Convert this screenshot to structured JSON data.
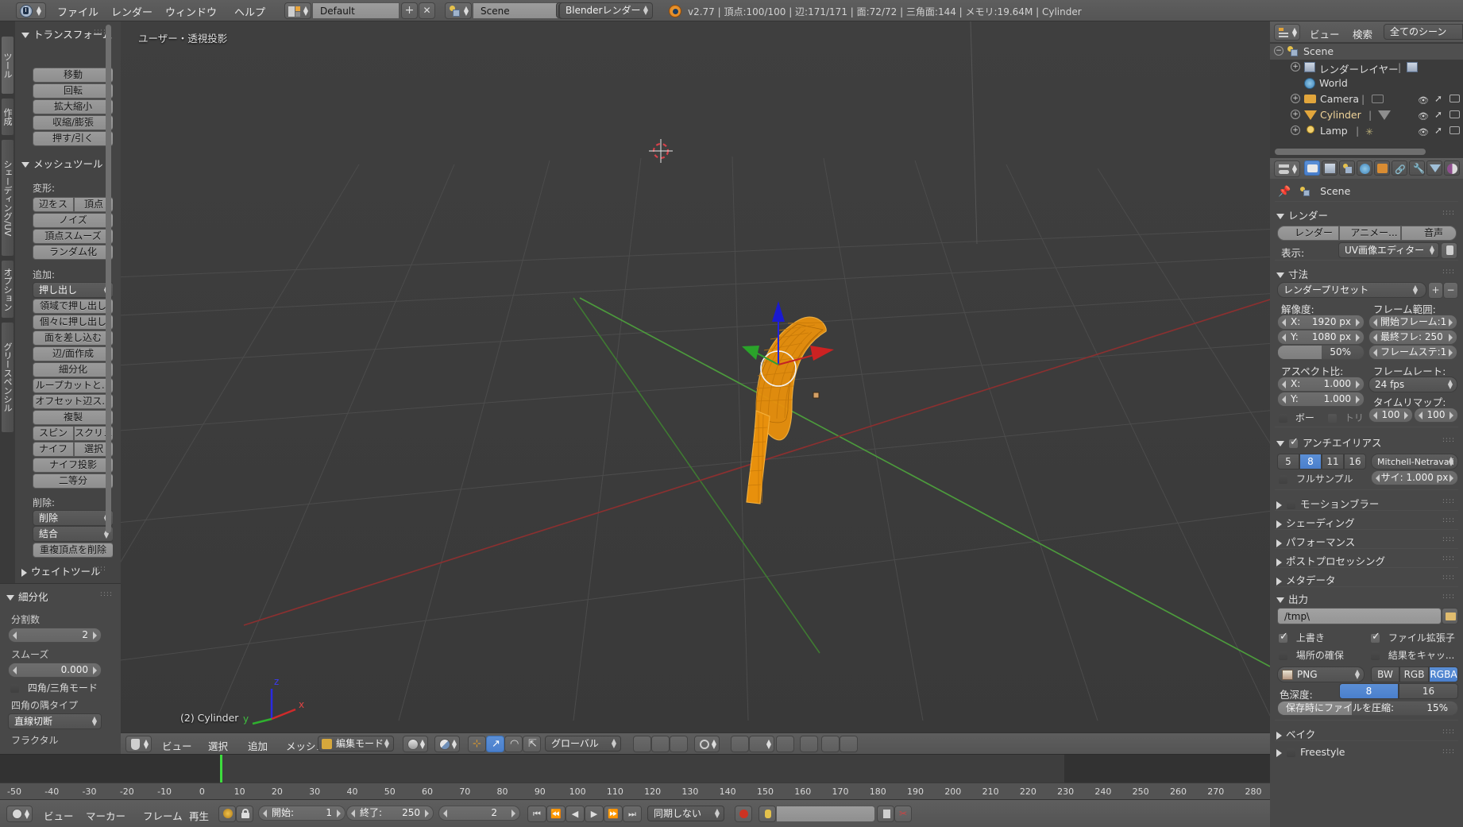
{
  "topbar": {
    "menus": [
      "ファイル",
      "レンダー",
      "ウィンドウ",
      "ヘルプ"
    ],
    "screen_layout": "Default",
    "scene_name": "Scene",
    "render_engine": "Blenderレンダー",
    "status": "v2.77 | 頂点:100/100 | 辺:171/171 | 面:72/72 | 三角面:144 | メモリ:19.64M | Cylinder"
  },
  "toolshelf": {
    "tabs": [
      "ツール",
      "作成",
      "シェーディング/UV",
      "オプション",
      "グリースペンシル"
    ],
    "transform": {
      "title": "トランスフォーム",
      "buttons": [
        "移動",
        "回転",
        "拡大縮小",
        "収縮/膨張",
        "押す/引く"
      ]
    },
    "meshtools": {
      "title": "メッシュツール",
      "deform_label": "変形:",
      "deform_buttons": [
        "辺をス",
        "頂点"
      ],
      "deform_rows": [
        "ノイズ",
        "頂点スムーズ",
        "ランダム化"
      ],
      "add_label": "追加:",
      "add_dropdown": "押し出し",
      "add_rows": [
        "領域で押し出し",
        "個々に押し出し",
        "面を差し込む",
        "辺/面作成",
        "細分化",
        "ループカットと...",
        "オフセット辺ス...",
        "複製"
      ],
      "pair1": [
        "スピン",
        "スクリュ"
      ],
      "pair2": [
        "ナイフ",
        "選択"
      ],
      "add_rows2": [
        "ナイフ投影",
        "二等分"
      ],
      "remove_label": "削除:",
      "remove_dd1": "削除",
      "remove_dd2": "結合",
      "remove_btn": "重複頂点を削除",
      "weight_title": "ウェイトツール"
    },
    "subdivide": {
      "title": "細分化",
      "cuts_label": "分割数",
      "cuts_value": "2",
      "smooth_label": "スムーズ",
      "smooth_value": "0.000",
      "quadtri_label": "四角/三角モード",
      "corner_label": "四角の隅タイプ",
      "corner_value": "直線切断",
      "fractal_label": "フラクタル"
    }
  },
  "viewport": {
    "view_label": "ユーザー・透視投影",
    "object_label": "(2) Cylinder",
    "axis_x": "x",
    "axis_y": "y",
    "axis_z": "z",
    "header_menus": [
      "ビュー",
      "選択",
      "追加",
      "メッシュ"
    ],
    "mode": "編集モード",
    "transform_orientation": "グローバル"
  },
  "timeline": {
    "ruler_ticks": [
      "-50",
      "-40",
      "-30",
      "-20",
      "-10",
      "0",
      "10",
      "20",
      "30",
      "40",
      "50",
      "60",
      "70",
      "80",
      "90",
      "100",
      "110",
      "120",
      "130",
      "140",
      "150",
      "160",
      "170",
      "180",
      "190",
      "200",
      "210",
      "220",
      "230",
      "240",
      "250",
      "260",
      "270",
      "280"
    ],
    "menus": [
      "ビュー",
      "マーカー",
      "フレーム",
      "再生"
    ],
    "start_label": "開始:",
    "start_value": "1",
    "end_label": "終了:",
    "end_value": "250",
    "current_frame": "2",
    "sync_mode": "同期しない"
  },
  "outliner": {
    "view_menu": "ビュー",
    "search_menu": "検索",
    "display_mode": "全てのシーン",
    "rows": [
      {
        "label": "Scene",
        "icon": "scene-icon",
        "depth": 0
      },
      {
        "label": "レンダーレイヤー",
        "icon": "renderlayer-icon",
        "depth": 1
      },
      {
        "label": "World",
        "icon": "world-icon",
        "depth": 1
      },
      {
        "label": "Camera",
        "icon": "camera-icon",
        "depth": 1
      },
      {
        "label": "Cylinder",
        "icon": "mesh-icon",
        "depth": 1
      },
      {
        "label": "Lamp",
        "icon": "lamp-icon",
        "depth": 1
      }
    ]
  },
  "properties": {
    "breadcrumb": "Scene",
    "render": {
      "title": "レンダー",
      "render_btn": "レンダー",
      "anim_btn": "アニメー...",
      "audio_btn": "音声",
      "display_label": "表示:",
      "display_value": "UV画像エディター"
    },
    "dimensions": {
      "title": "寸法",
      "preset": "レンダープリセット",
      "resolution_label": "解像度:",
      "res_x_label": "X:",
      "res_x_value": "1920 px",
      "res_y_label": "Y:",
      "res_y_value": "1080 px",
      "res_percent": "50%",
      "aspect_label": "アスペクト比:",
      "aspect_x_label": "X:",
      "aspect_x_value": "1.000",
      "aspect_y_label": "Y:",
      "aspect_y_value": "1.000",
      "border_label": "ボー",
      "crop_label": "トリ",
      "framerange_label": "フレーム範囲:",
      "frame_start": "開始フレーム:1",
      "frame_end": "最終フレ:  250",
      "frame_step": "フレームステ:1",
      "framerate_label": "フレームレート:",
      "framerate_value": "24 fps",
      "timeremap_label": "タイムリマップ:",
      "remap_old": "100",
      "remap_new": "100"
    },
    "antialiasing": {
      "title": "アンチエイリアス",
      "samples": [
        "5",
        "8",
        "11",
        "16"
      ],
      "samples_active": "8",
      "filter": "Mitchell-Netravali",
      "fullsample_label": "フルサンプル",
      "size_label": "サイ: 1.000 px"
    },
    "collapsed": [
      "モーションブラー",
      "シェーディング",
      "パフォーマンス",
      "ポストプロセッシング",
      "メタデータ"
    ],
    "output": {
      "title": "出力",
      "path": "/tmp\\",
      "overwrite_label": "上書き",
      "fileext_label": "ファイル拡張子",
      "placeholder_label": "場所の確保",
      "cache_label": "結果をキャッ...",
      "format": "PNG",
      "color_modes": [
        "BW",
        "RGB",
        "RGBA"
      ],
      "color_mode_active": "RGBA",
      "depth_label": "色深度:",
      "depths": [
        "8",
        "16"
      ],
      "depth_active": "8",
      "compression_label": "保存時にファイルを圧縮:",
      "compression_value": "15%"
    },
    "bake_title": "ベイク",
    "freestyle_title": "Freestyle"
  },
  "colors": {
    "accent_blue": "#4a7fcc",
    "mesh_orange": "#e8900c",
    "axis_x_red": "#c34040",
    "axis_y_green": "#4cae3d",
    "axis_z_blue": "#2222dd"
  }
}
